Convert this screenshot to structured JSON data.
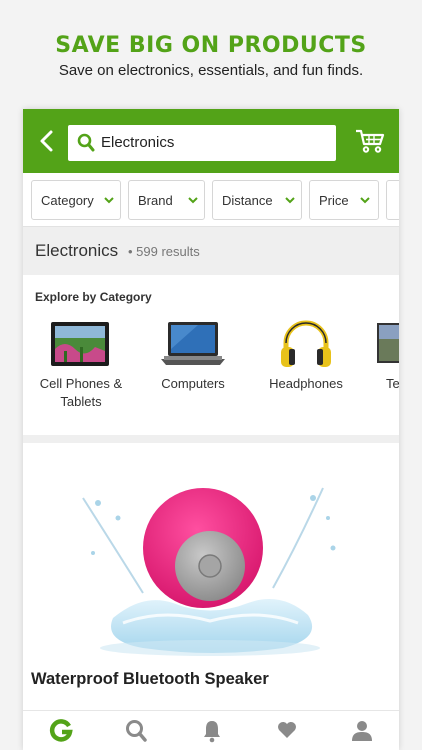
{
  "promo": {
    "title": "SAVE BIG ON PRODUCTS",
    "subtitle": "Save on electronics, essentials, and fun finds."
  },
  "header": {
    "back_icon": "chevron-left-icon",
    "search_icon": "search-icon",
    "search_value": "Electronics",
    "cart_icon": "shopping-cart-icon",
    "accent_color": "#53a318"
  },
  "filters": [
    {
      "label": "Category"
    },
    {
      "label": "Brand"
    },
    {
      "label": "Distance"
    },
    {
      "label": "Price"
    }
  ],
  "results": {
    "title": "Electronics",
    "count": "• 599 results"
  },
  "explore": {
    "title": "Explore by Category",
    "categories": [
      {
        "label": "Cell Phones & Tablets",
        "icon": "tablet-icon"
      },
      {
        "label": "Computers",
        "icon": "laptop-icon"
      },
      {
        "label": "Headphones",
        "icon": "headphones-icon"
      },
      {
        "label": "Te",
        "icon": "tv-icon"
      }
    ]
  },
  "product": {
    "name": "Waterproof Bluetooth Speaker",
    "image": "speaker-splash-image"
  },
  "tabbar": [
    {
      "icon": "groupon-logo-icon"
    },
    {
      "icon": "search-icon"
    },
    {
      "icon": "bell-icon"
    },
    {
      "icon": "heart-icon"
    },
    {
      "icon": "user-icon"
    }
  ]
}
